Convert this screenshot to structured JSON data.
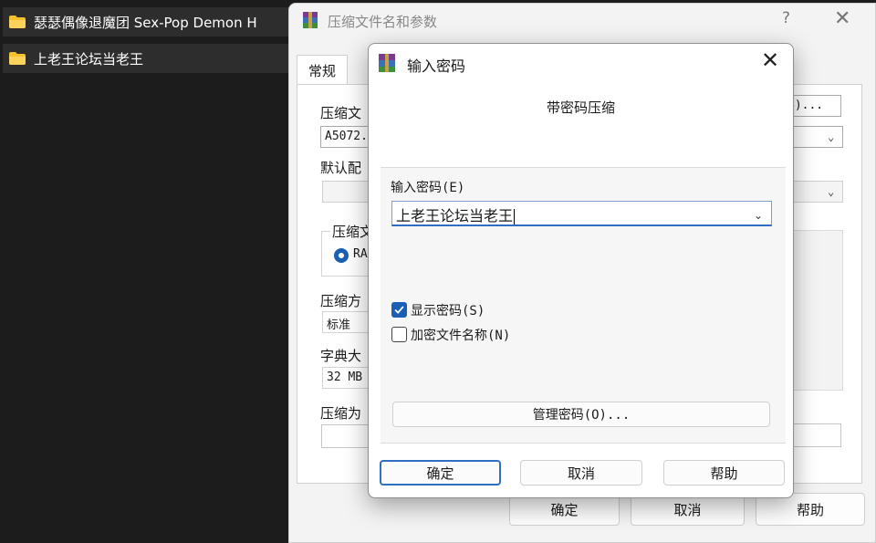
{
  "explorer": {
    "rows": [
      {
        "label": "瑟瑟偶像退魔团 Sex-Pop Demon H"
      },
      {
        "label": "上老王论坛当老王"
      }
    ]
  },
  "parent_dialog": {
    "title": "压缩文件名和参数",
    "help_symbol": "?",
    "close_symbol": "✕",
    "tab_label": "常规",
    "archive_name_label": "压缩文",
    "archive_name_value": "A5072.",
    "browse_button_partial": "B)...",
    "profile_label": "默认配",
    "format_group_label": "压缩文",
    "format_radio_label": "RA",
    "method_label": "压缩方",
    "method_value": "标准",
    "dict_label": "字典大",
    "dict_value": "32 MB",
    "split_label": "压缩为",
    "ok_label": "确定",
    "cancel_label": "取消",
    "help_label": "帮助"
  },
  "modal": {
    "title": "输入密码",
    "close_symbol": "✕",
    "heading": "带密码压缩",
    "password_label": "输入密码(E)",
    "password_value": "上老王论坛当老王",
    "show_password_label": "显示密码(S)",
    "show_password_checked": true,
    "encrypt_names_label": "加密文件名称(N)",
    "encrypt_names_checked": false,
    "manage_button": "管理密码(O)...",
    "ok_label": "确定",
    "cancel_label": "取消",
    "help_label": "帮助",
    "accent_color": "#1a5fb4"
  },
  "icons": {
    "folder": "folder-icon",
    "winrar": "winrar-icon",
    "check": "check-icon",
    "chevron": "chevron-down-icon"
  }
}
